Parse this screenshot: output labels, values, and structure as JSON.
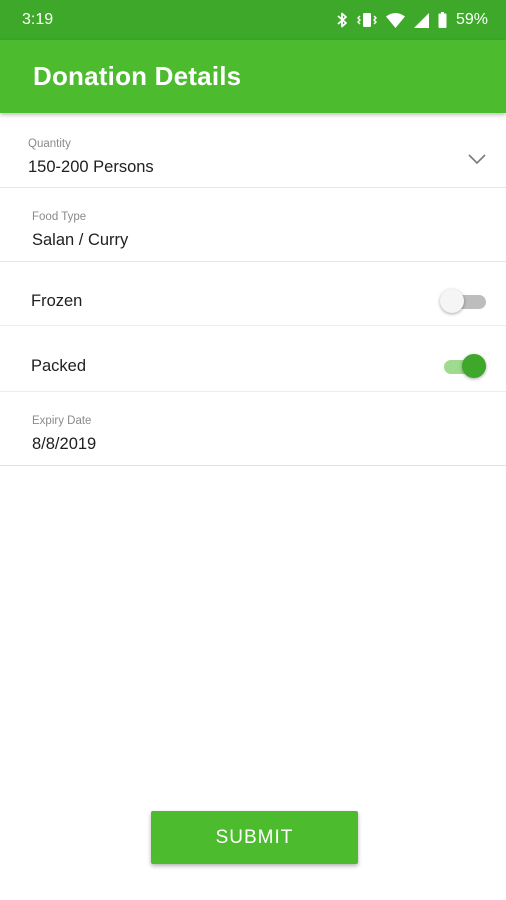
{
  "status_bar": {
    "time": "3:19",
    "battery_percent": "59%",
    "icons": [
      "bluetooth-icon",
      "vibrate-icon",
      "wifi-icon",
      "signal-icon",
      "battery-icon"
    ]
  },
  "app_bar": {
    "title": "Donation Details",
    "color": "#4cbb2e"
  },
  "form": {
    "quantity": {
      "label": "Quantity",
      "value": "150-200 Persons",
      "icon": "chevron-down-icon"
    },
    "food_type": {
      "label": "Food Type",
      "value": "Salan / Curry"
    },
    "frozen": {
      "label": "Frozen",
      "checked": false
    },
    "packed": {
      "label": "Packed",
      "checked": true
    },
    "expiry_date": {
      "label": "Expiry Date",
      "value": "8/8/2019"
    }
  },
  "submit": {
    "label": "SUBMIT"
  }
}
